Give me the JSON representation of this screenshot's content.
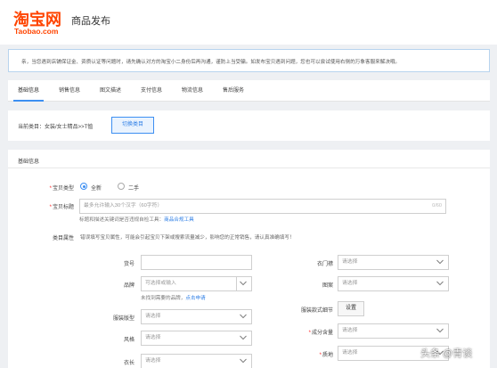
{
  "header": {
    "logo_main": "淘宝网",
    "logo_sub": "Taobao.com",
    "title": "商品发布",
    "brand_color": "#ff4400"
  },
  "notice": {
    "text": "亲，当您遇到店铺保证金、资质认证等问题时，请先确认对方的淘宝小二身份后再沟通，谨防上当受骗。如发布宝贝遇到问题，您也可以尝试使用右侧的万象客服来解决哦。"
  },
  "tabs": [
    {
      "label": "基础信息",
      "active": true
    },
    {
      "label": "销售信息",
      "active": false
    },
    {
      "label": "图文描述",
      "active": false
    },
    {
      "label": "支付信息",
      "active": false
    },
    {
      "label": "物流信息",
      "active": false
    },
    {
      "label": "售后服务",
      "active": false
    }
  ],
  "category": {
    "text": "当前类目：女装/女士精品>>T恤",
    "switch_label": "切换类目"
  },
  "basic": {
    "section_title": "基础信息",
    "item_type_label": "宝贝类型",
    "item_type_options": [
      "全新",
      "二手"
    ],
    "item_type_selected": "全新",
    "title_label": "宝贝标题",
    "title_placeholder": "最多允许输入30个汉字（60字符）",
    "title_counter": "0/60",
    "title_hint": "标题和描述关键词是否违规自检工具：",
    "title_hint_link": "商品合规工具",
    "attr_label": "类目属性",
    "attr_hint": "错误填写宝贝属性，可能会引起宝贝下架或搜索流量减少，影响您的正常销售，请认真准确填写！"
  },
  "attrs": {
    "huohao_label": "货号",
    "pinpai_label": "品牌",
    "pinpai_placeholder": "可选择或输入",
    "pinpai_hint": "未找到需要的品牌，",
    "pinpai_hint_link": "点击申请",
    "banxing_label": "服装版型",
    "fengge_label": "风格",
    "yichang_label": "衣长",
    "menjin_label": "衣门襟",
    "tuan_label": "图案",
    "kuanshi_label": "服装款式细节",
    "kuanshi_button": "设置",
    "chengfen_label": "成分含量",
    "zhidi_label": "质地",
    "select_placeholder": "请选择"
  },
  "watermark": "头条 @青谈",
  "colors": {
    "accent": "#3d8ff2",
    "required": "#ff2222",
    "link": "#2f7fe6"
  }
}
